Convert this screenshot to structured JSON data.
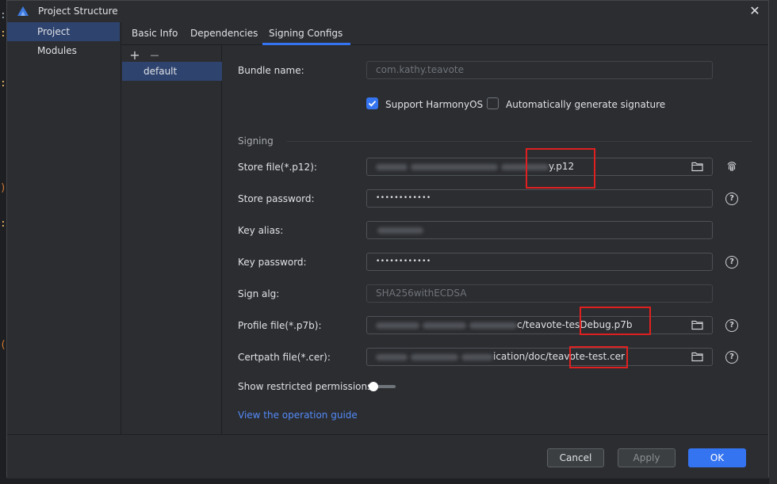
{
  "window": {
    "title": "Project Structure",
    "close": "✕"
  },
  "left_nav": {
    "items": [
      {
        "label": "Project"
      },
      {
        "label": "Modules"
      }
    ]
  },
  "tabs": [
    {
      "label": "Basic Info"
    },
    {
      "label": "Dependencies"
    },
    {
      "label": "Signing Configs"
    }
  ],
  "configs": {
    "add": "+",
    "remove": "—",
    "items": [
      {
        "label": "default"
      }
    ]
  },
  "form": {
    "bundle_name": {
      "label": "Bundle name:",
      "value": "com.kathy.teavote"
    },
    "support_harmonyos": {
      "label": "Support HarmonyOS",
      "checked": true
    },
    "auto_signature": {
      "label": "Automatically generate signature",
      "checked": false
    },
    "signing_section": "Signing",
    "store_file": {
      "label": "Store file(*.p12):",
      "value_visible": "y.p12"
    },
    "store_password": {
      "label": "Store password:",
      "value": "••••••••••••"
    },
    "key_alias": {
      "label": "Key alias:"
    },
    "key_password": {
      "label": "Key password:",
      "value": "••••••••••••"
    },
    "sign_alg": {
      "label": "Sign alg:",
      "value": "SHA256withECDSA"
    },
    "profile_file": {
      "label": "Profile file(*.p7b):",
      "value_visible": "c/teavote-tes",
      "value_highlight": "Debug.p7b"
    },
    "certpath_file": {
      "label": "Certpath file(*.cer):",
      "value_visible": "ication/doc/teavote-t",
      "value_highlight": "est.cer"
    },
    "show_restricted": {
      "label": "Show restricted permissions",
      "on": false
    },
    "guide_link": "View the operation guide",
    "help": "?"
  },
  "footer": {
    "cancel": "Cancel",
    "apply": "Apply",
    "ok": "OK"
  },
  "colors": {
    "accent": "#3574f0",
    "selection": "#2e436e",
    "highlight_box": "#e02020",
    "link": "#548af7"
  }
}
